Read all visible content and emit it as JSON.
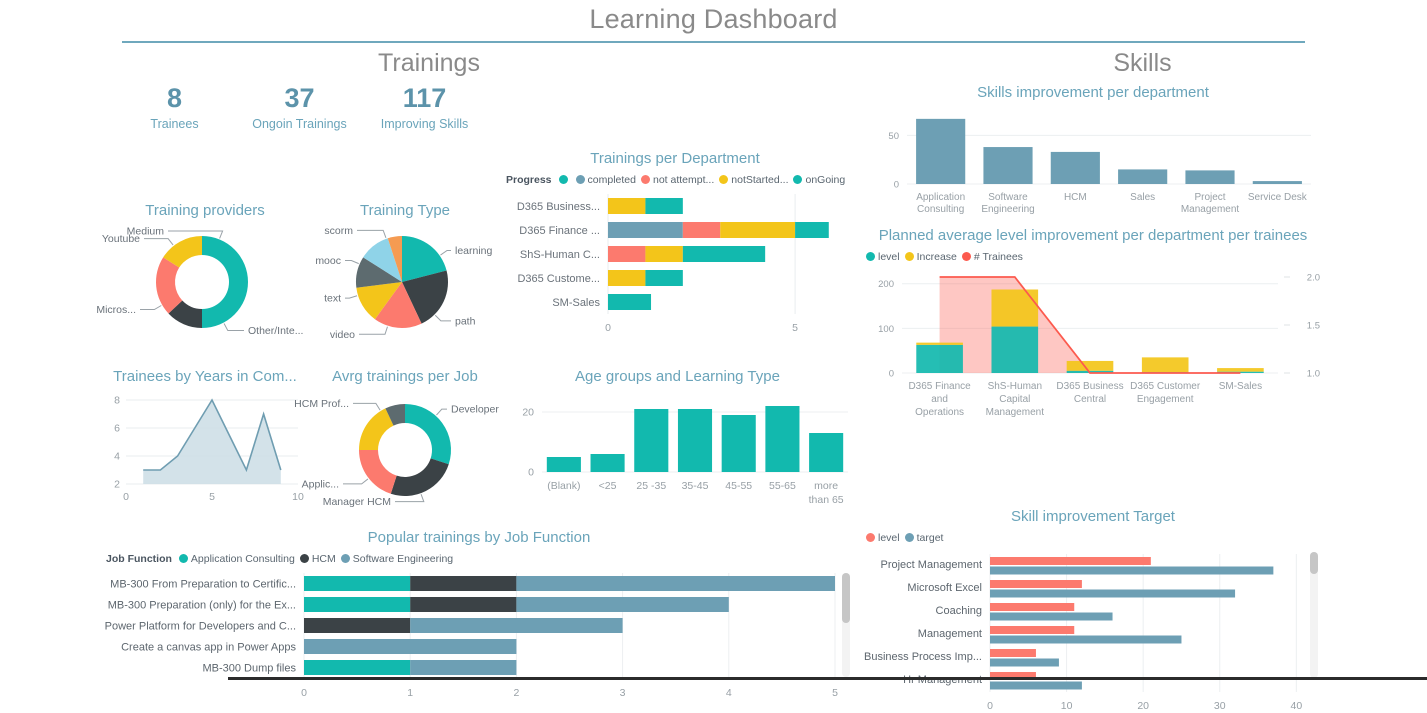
{
  "header": {
    "title": "Learning Dashboard",
    "accent": "#6fa8bd"
  },
  "sections": {
    "left": "Trainings",
    "right": "Skills"
  },
  "kpis": [
    {
      "value": "8",
      "label": "Trainees"
    },
    {
      "value": "37",
      "label": "Ongoin Trainings"
    },
    {
      "value": "117",
      "label": "Improving Skills"
    }
  ],
  "colors": {
    "teal": "#12b9ae",
    "dark": "#3b4246",
    "red": "#fc7a6e",
    "yellow": "#f3c51a",
    "steel": "#6d9fb4",
    "gray": "#5d6b6f",
    "lightblue": "#8fd3e8",
    "orange": "#f59b52",
    "area_line": "#6f9db1",
    "area_fill": "#cbdde5"
  },
  "chart_data": [
    {
      "id": "training-providers",
      "type": "pie",
      "title": "Training providers",
      "donut": true,
      "labels": [
        "Other/Inte...",
        "Micros...",
        "Youtube",
        "Medium"
      ],
      "values": [
        50,
        13,
        21,
        16
      ],
      "colors": [
        "#12b9ae",
        "#3b4246",
        "#fc7a6e",
        "#f3c51a"
      ]
    },
    {
      "id": "training-type",
      "type": "pie",
      "title": "Training Type",
      "donut": false,
      "labels": [
        "learning",
        "path",
        "video",
        "text",
        "mooc",
        "scorm",
        ""
      ],
      "values": [
        21,
        22,
        17,
        13,
        11,
        11,
        5
      ],
      "colors": [
        "#12b9ae",
        "#3b4246",
        "#fc7a6e",
        "#f3c51a",
        "#5d6b6f",
        "#8fd3e8",
        "#f59b52"
      ]
    },
    {
      "id": "trainees-years",
      "type": "area",
      "title": "Trainees by Years in Com...",
      "x": [
        1,
        2,
        3,
        4,
        5,
        6,
        7,
        8,
        9
      ],
      "values": [
        3,
        3,
        4,
        6,
        8,
        5.5,
        3,
        7,
        3
      ],
      "xticks": [
        "0",
        "5",
        "10"
      ],
      "yticks": [
        "2",
        "4",
        "6",
        "8"
      ],
      "xlim": [
        0,
        10
      ],
      "ylim": [
        2,
        8
      ]
    },
    {
      "id": "avrg-trainings-job",
      "type": "pie",
      "title": "Avrg trainings per Job",
      "donut": true,
      "labels": [
        "Developer",
        "Manager HCM",
        "Applic...",
        "HCM Prof...",
        ""
      ],
      "values": [
        30,
        25,
        20,
        18,
        7
      ],
      "colors": [
        "#12b9ae",
        "#3b4246",
        "#fc7a6e",
        "#f3c51a",
        "#5d6b6f"
      ]
    },
    {
      "id": "trainings-per-department",
      "type": "bar",
      "orientation": "horizontal",
      "stacked": true,
      "title": "Trainings per Department",
      "legend_title": "Progress",
      "legend": [
        {
          "label": "",
          "color": "#12b9ae"
        },
        {
          "label": "completed",
          "color": "#6d9fb4"
        },
        {
          "label": "not attempt...",
          "color": "#fc7a6e"
        },
        {
          "label": "notStarted...",
          "color": "#f3c51a"
        },
        {
          "label": "onGoing",
          "color": "#12b9ae"
        }
      ],
      "categories": [
        "D365 Business...",
        "D365 Finance ...",
        "ShS-Human C...",
        "D365 Custome...",
        "SM-Sales"
      ],
      "series": [
        {
          "name": "completed",
          "color": "#6d9fb4",
          "values": [
            0,
            2,
            0,
            0,
            0
          ]
        },
        {
          "name": "not attempt...",
          "color": "#fc7a6e",
          "values": [
            0,
            1,
            1,
            0,
            0
          ]
        },
        {
          "name": "notStarted...",
          "color": "#f3c51a",
          "values": [
            1,
            2,
            1,
            1,
            0
          ]
        },
        {
          "name": "onGoing",
          "color": "#12b9ae",
          "values": [
            1,
            0.9,
            2.2,
            1,
            1.15
          ]
        }
      ],
      "xticks": [
        "0",
        "5"
      ],
      "xlim": [
        0,
        6.2
      ]
    },
    {
      "id": "age-groups-learning-type",
      "type": "bar",
      "orientation": "vertical",
      "title": "Age groups and Learning Type",
      "categories": [
        "(Blank)",
        "<25",
        "25 -35",
        "35-45",
        "45-55",
        "55-65",
        "more than 65"
      ],
      "values": [
        5,
        6,
        21,
        21,
        19,
        22,
        13
      ],
      "yticks": [
        "0",
        "20"
      ],
      "ylim": [
        0,
        24
      ],
      "color": "#12b9ae"
    },
    {
      "id": "popular-trainings-by-job-function",
      "type": "bar",
      "orientation": "horizontal",
      "stacked": true,
      "title": "Popular trainings by Job Function",
      "legend_title": "Job Function",
      "legend": [
        {
          "label": "Application Consulting",
          "color": "#12b9ae"
        },
        {
          "label": "HCM",
          "color": "#3b4246"
        },
        {
          "label": "Software Engineering",
          "color": "#6d9fb4"
        }
      ],
      "categories": [
        "MB-300 From Preparation to Certific...",
        "MB-300 Preparation (only) for the Ex...",
        "Power Platform for Developers and C...",
        "Create a canvas app in Power Apps",
        "MB-300 Dump files"
      ],
      "series": [
        {
          "name": "Application Consulting",
          "color": "#12b9ae",
          "values": [
            1,
            1,
            0,
            0,
            1
          ]
        },
        {
          "name": "HCM",
          "color": "#3b4246",
          "values": [
            1,
            1,
            1,
            0,
            0
          ]
        },
        {
          "name": "Software Engineering",
          "color": "#6d9fb4",
          "values": [
            3,
            2,
            2,
            2,
            1
          ]
        }
      ],
      "xticks": [
        "0",
        "1",
        "2",
        "3",
        "4",
        "5"
      ],
      "xlim": [
        0,
        5
      ]
    },
    {
      "id": "skills-improvement-per-department",
      "type": "bar",
      "orientation": "vertical",
      "title": "Skills improvement per department",
      "categories": [
        "Application Consulting",
        "Software Engineering",
        "HCM",
        "Sales",
        "Project Management",
        "Service Desk"
      ],
      "values": [
        67,
        38,
        33,
        15,
        14,
        3
      ],
      "yticks": [
        "0",
        "50"
      ],
      "ylim": [
        0,
        72
      ],
      "color": "#6d9fb4"
    },
    {
      "id": "planned-average-level-improvement",
      "type": "bar",
      "orientation": "vertical",
      "stacked": true,
      "combo": true,
      "title": "Planned average level improvement per department per trainees",
      "legend": [
        {
          "label": "level",
          "color": "#12b9ae"
        },
        {
          "label": "Increase",
          "color": "#f3c51a"
        },
        {
          "label": "# Trainees",
          "color": "#fc5a4e"
        }
      ],
      "categories": [
        "D365 Finance and Operations",
        "ShS-Human Capital Management",
        "D365 Business Central",
        "D365 Customer Engagement",
        "SM-Sales"
      ],
      "series": [
        {
          "name": "level",
          "color": "#12b9ae",
          "values": [
            63,
            104,
            5,
            2,
            3
          ]
        },
        {
          "name": "Increase",
          "color": "#f3c51a",
          "values": [
            5,
            83,
            22,
            33,
            8
          ]
        }
      ],
      "line_series": {
        "name": "# Trainees",
        "color": "#fc5a4e",
        "values": [
          2.0,
          2.0,
          1.0,
          1.0,
          1.0
        ]
      },
      "yticks": [
        "0",
        "100",
        "200"
      ],
      "ylim": [
        0,
        215
      ],
      "y2ticks": [
        "1.0",
        "1.5",
        "2.0"
      ],
      "y2lim": [
        1.0,
        2.0
      ]
    },
    {
      "id": "skill-improvement-target",
      "type": "bar",
      "orientation": "horizontal",
      "grouped": true,
      "title": "Skill improvement Target",
      "legend": [
        {
          "label": "level",
          "color": "#fc7a6e"
        },
        {
          "label": "target",
          "color": "#6d9fb4"
        }
      ],
      "categories": [
        "Project Management",
        "Microsoft Excel",
        "Coaching",
        "Management",
        "Business Process Imp...",
        "Hr Management"
      ],
      "series": [
        {
          "name": "level",
          "color": "#fc7a6e",
          "values": [
            21,
            12,
            11,
            11,
            6,
            6
          ]
        },
        {
          "name": "target",
          "color": "#6d9fb4",
          "values": [
            37,
            32,
            16,
            25,
            9,
            12
          ]
        }
      ],
      "xticks": [
        "0",
        "10",
        "20",
        "30",
        "40"
      ],
      "xlim": [
        0,
        41
      ]
    }
  ]
}
